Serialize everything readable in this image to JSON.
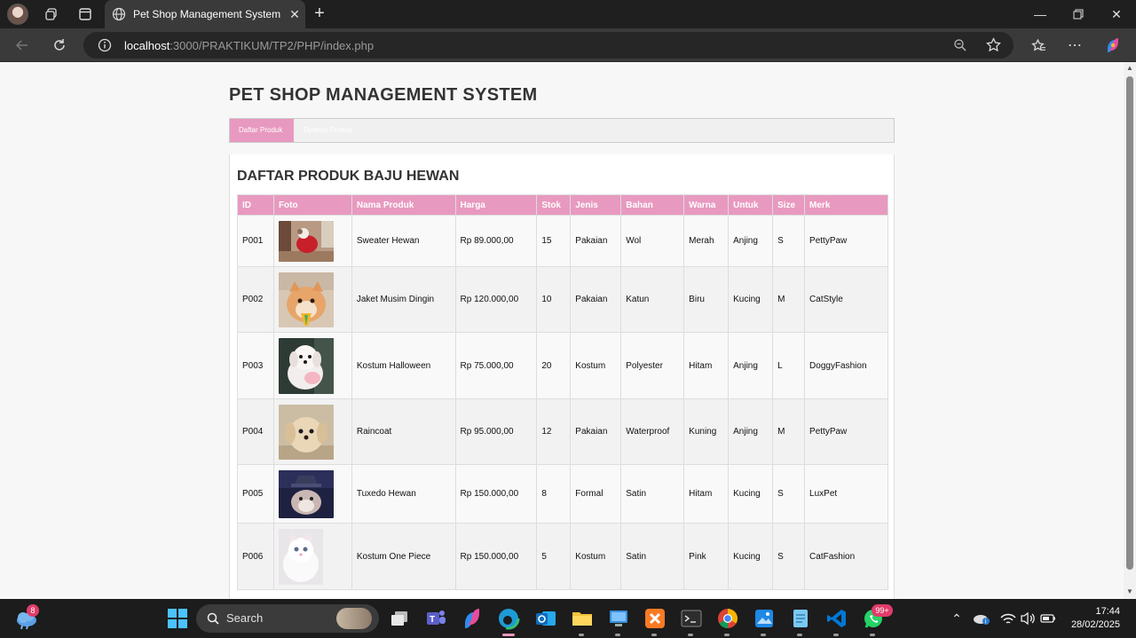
{
  "browser": {
    "tab_title": "Pet Shop Management System",
    "url_host": "localhost",
    "url_rest": ":3000/PRAKTIKUM/TP2/PHP/index.php"
  },
  "page": {
    "title": "PET SHOP MANAGEMENT SYSTEM",
    "nav": [
      {
        "label": "Daftar Produk",
        "active": true
      },
      {
        "label": "Tambah Produk",
        "active": false
      }
    ],
    "section_title": "DAFTAR PRODUK BAJU HEWAN",
    "columns": [
      "ID",
      "Foto",
      "Nama Produk",
      "Harga",
      "Stok",
      "Jenis",
      "Bahan",
      "Warna",
      "Untuk",
      "Size",
      "Merk"
    ],
    "products": [
      {
        "id": "P001",
        "photo": "dog-red-sweater",
        "nama": "Sweater Hewan",
        "harga": "Rp 89.000,00",
        "stok": "15",
        "jenis": "Pakaian",
        "bahan": "Wol",
        "warna": "Merah",
        "untuk": "Anjing",
        "size": "S",
        "merk": "PettyPaw"
      },
      {
        "id": "P002",
        "photo": "cat-orange",
        "nama": "Jaket Musim Dingin",
        "harga": "Rp 120.000,00",
        "stok": "10",
        "jenis": "Pakaian",
        "bahan": "Katun",
        "warna": "Biru",
        "untuk": "Kucing",
        "size": "M",
        "merk": "CatStyle"
      },
      {
        "id": "P003",
        "photo": "dog-white-costume",
        "nama": "Kostum Halloween",
        "harga": "Rp 75.000,00",
        "stok": "20",
        "jenis": "Kostum",
        "bahan": "Polyester",
        "warna": "Hitam",
        "untuk": "Anjing",
        "size": "L",
        "merk": "DoggyFashion"
      },
      {
        "id": "P004",
        "photo": "dog-cream-puppy",
        "nama": "Raincoat",
        "harga": "Rp 95.000,00",
        "stok": "12",
        "jenis": "Pakaian",
        "bahan": "Waterproof",
        "warna": "Kuning",
        "untuk": "Anjing",
        "size": "M",
        "merk": "PettyPaw"
      },
      {
        "id": "P005",
        "photo": "cat-tuxedo-hat",
        "nama": "Tuxedo Hewan",
        "harga": "Rp 150.000,00",
        "stok": "8",
        "jenis": "Formal",
        "bahan": "Satin",
        "warna": "Hitam",
        "untuk": "Kucing",
        "size": "S",
        "merk": "LuxPet"
      },
      {
        "id": "P006",
        "photo": "cat-white-fluffy",
        "nama": "Kostum One Piece",
        "harga": "Rp 150.000,00",
        "stok": "5",
        "jenis": "Kostum",
        "bahan": "Satin",
        "warna": "Pink",
        "untuk": "Kucing",
        "size": "S",
        "merk": "CatFashion"
      }
    ]
  },
  "taskbar": {
    "search_label": "Search",
    "weather_badge": "8",
    "whatsapp_badge": "99+",
    "time": "17:44",
    "date": "28/02/2025"
  },
  "colors": {
    "accent_pink": "#e899bf",
    "header_text": "#333333"
  }
}
